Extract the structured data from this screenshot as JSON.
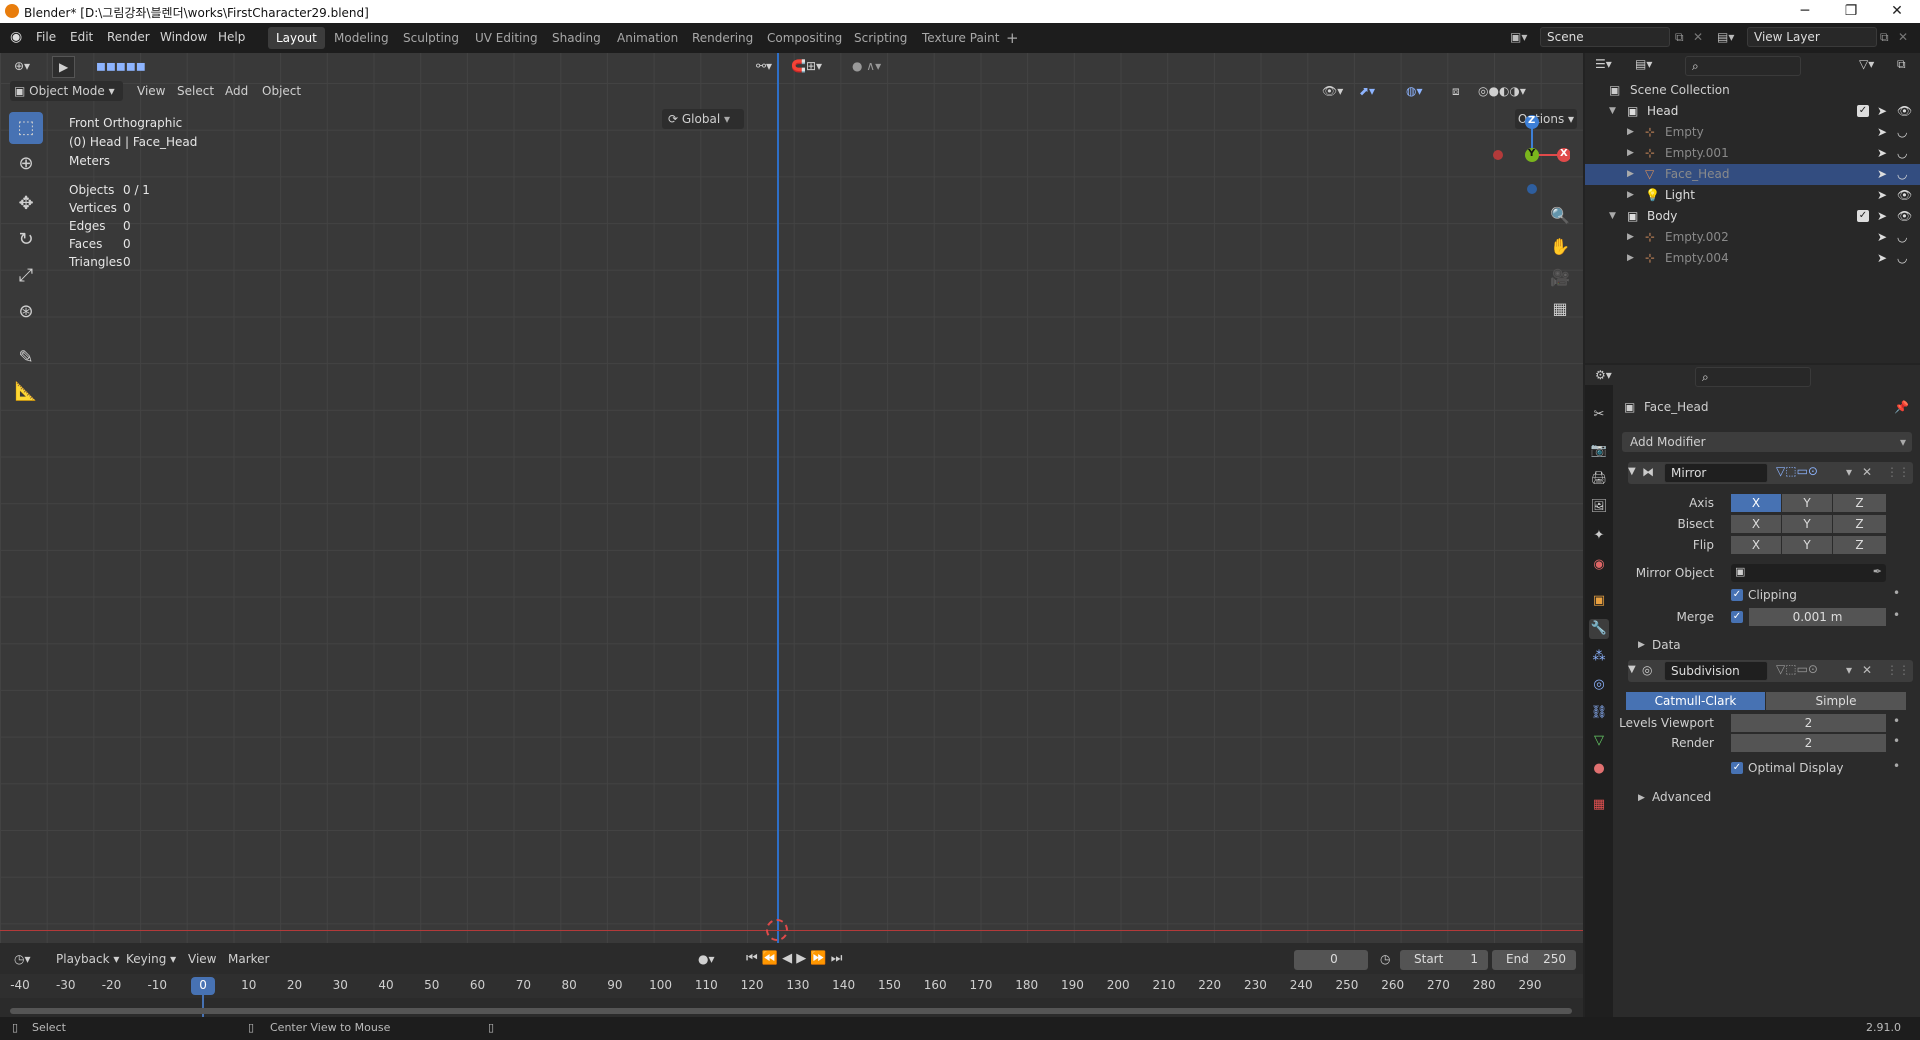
{
  "window": {
    "title": "Blender* [D:\\그림강좌\\블렌더\\works\\FirstCharacter29.blend]",
    "minimize": "─",
    "maximize": "❐",
    "close": "✕"
  },
  "menu": {
    "items": [
      "File",
      "Edit",
      "Render",
      "Window",
      "Help"
    ]
  },
  "workspaces": {
    "tabs": [
      "Layout",
      "Modeling",
      "Sculpting",
      "UV Editing",
      "Shading",
      "Animation",
      "Rendering",
      "Compositing",
      "Scripting",
      "Texture Paint"
    ],
    "active": "Layout",
    "add": "+"
  },
  "scene": {
    "label": "Scene",
    "view_layer": "View Layer"
  },
  "viewport": {
    "mode": "Object Mode",
    "menus": [
      "View",
      "Select",
      "Add",
      "Object"
    ],
    "orientation": "Global",
    "options": "Options",
    "view_name": "Front Orthographic",
    "context": "(0) Head | Face_Head",
    "units": "Meters",
    "stats": [
      {
        "label": "Objects",
        "value": "0 / 1"
      },
      {
        "label": "Vertices",
        "value": "0"
      },
      {
        "label": "Edges",
        "value": "0"
      },
      {
        "label": "Faces",
        "value": "0"
      },
      {
        "label": "Triangles",
        "value": "0"
      }
    ],
    "gizmo": {
      "z": "Z",
      "y": "Y",
      "x": "X"
    }
  },
  "outliner": {
    "root": "Scene Collection",
    "rows": [
      {
        "name": "Head",
        "type": "collection"
      },
      {
        "name": "Empty",
        "type": "empty"
      },
      {
        "name": "Empty.001",
        "type": "empty"
      },
      {
        "name": "Face_Head",
        "type": "mesh",
        "selected": true
      },
      {
        "name": "Light",
        "type": "light"
      },
      {
        "name": "Body",
        "type": "collection"
      },
      {
        "name": "Empty.002",
        "type": "empty"
      },
      {
        "name": "Empty.004",
        "type": "empty"
      }
    ]
  },
  "properties": {
    "object_name": "Face_Head",
    "add_modifier": "Add Modifier",
    "mirror": {
      "name": "Mirror",
      "axis_label": "Axis",
      "bisect_label": "Bisect",
      "flip_label": "Flip",
      "xyz": [
        "X",
        "Y",
        "Z"
      ],
      "mirror_object_label": "Mirror Object",
      "clipping": "Clipping",
      "merge_label": "Merge",
      "merge_value": "0.001 m",
      "data": "Data"
    },
    "subdivision": {
      "name": "Subdivision",
      "catmull": "Catmull-Clark",
      "simple": "Simple",
      "levels_label": "Levels Viewport",
      "levels_value": "2",
      "render_label": "Render",
      "render_value": "2",
      "optimal": "Optimal Display",
      "advanced": "Advanced"
    }
  },
  "timeline": {
    "menus": [
      "Playback",
      "Keying",
      "View",
      "Marker"
    ],
    "current_frame": "0",
    "start_label": "Start",
    "start_value": "1",
    "end_label": "End",
    "end_value": "250",
    "ticks": [
      "-40",
      "-30",
      "-20",
      "-10",
      "0",
      "10",
      "20",
      "30",
      "40",
      "50",
      "60",
      "70",
      "80",
      "90",
      "100",
      "110",
      "120",
      "130",
      "140",
      "150",
      "160",
      "170",
      "180",
      "190",
      "200",
      "210",
      "220",
      "230",
      "240",
      "250",
      "260",
      "270",
      "280",
      "290"
    ]
  },
  "status": {
    "select": "Select",
    "center": "Center View to Mouse",
    "version": "2.91.0"
  },
  "colors": {
    "accent": "#4772b3",
    "selected_row": "#334d80",
    "axis_red": "#e04a4a",
    "axis_green": "#7ab51d",
    "axis_blue": "#3d7fd6"
  }
}
